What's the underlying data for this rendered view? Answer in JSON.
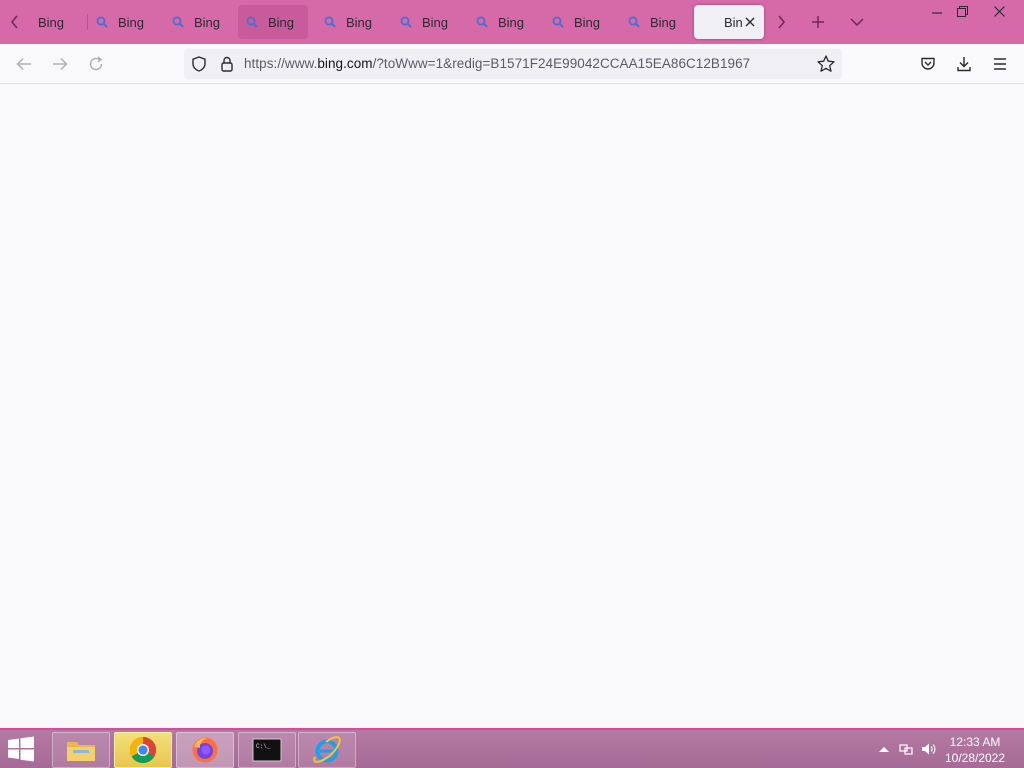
{
  "window": {
    "tabs": [
      {
        "label": "Bing",
        "state": "normal"
      },
      {
        "label": "Bing",
        "state": "normal"
      },
      {
        "label": "Bing",
        "state": "normal"
      },
      {
        "label": "Bing",
        "state": "hover"
      },
      {
        "label": "Bing",
        "state": "normal"
      },
      {
        "label": "Bing",
        "state": "normal"
      },
      {
        "label": "Bing",
        "state": "normal"
      },
      {
        "label": "Bing",
        "state": "normal"
      },
      {
        "label": "Bing",
        "state": "normal"
      },
      {
        "label": "Bin",
        "state": "active"
      }
    ]
  },
  "navbar": {
    "url_prefix": "https://www.",
    "url_domain": "bing.com",
    "url_rest": "/?toWww=1&redig=B1571F24E99042CCAA15EA86C12B1967"
  },
  "taskbar": {
    "apps": [
      "file-explorer-icon",
      "chrome-icon",
      "firefox-icon",
      "command-prompt-icon",
      "internet-explorer-icon"
    ],
    "clock_time": "12:33 AM",
    "clock_date": "10/28/2022"
  },
  "colors": {
    "tabstrip": "#d66aa8",
    "taskbar_accent": "#d44d96",
    "content_bg": "#f9f9fb"
  }
}
